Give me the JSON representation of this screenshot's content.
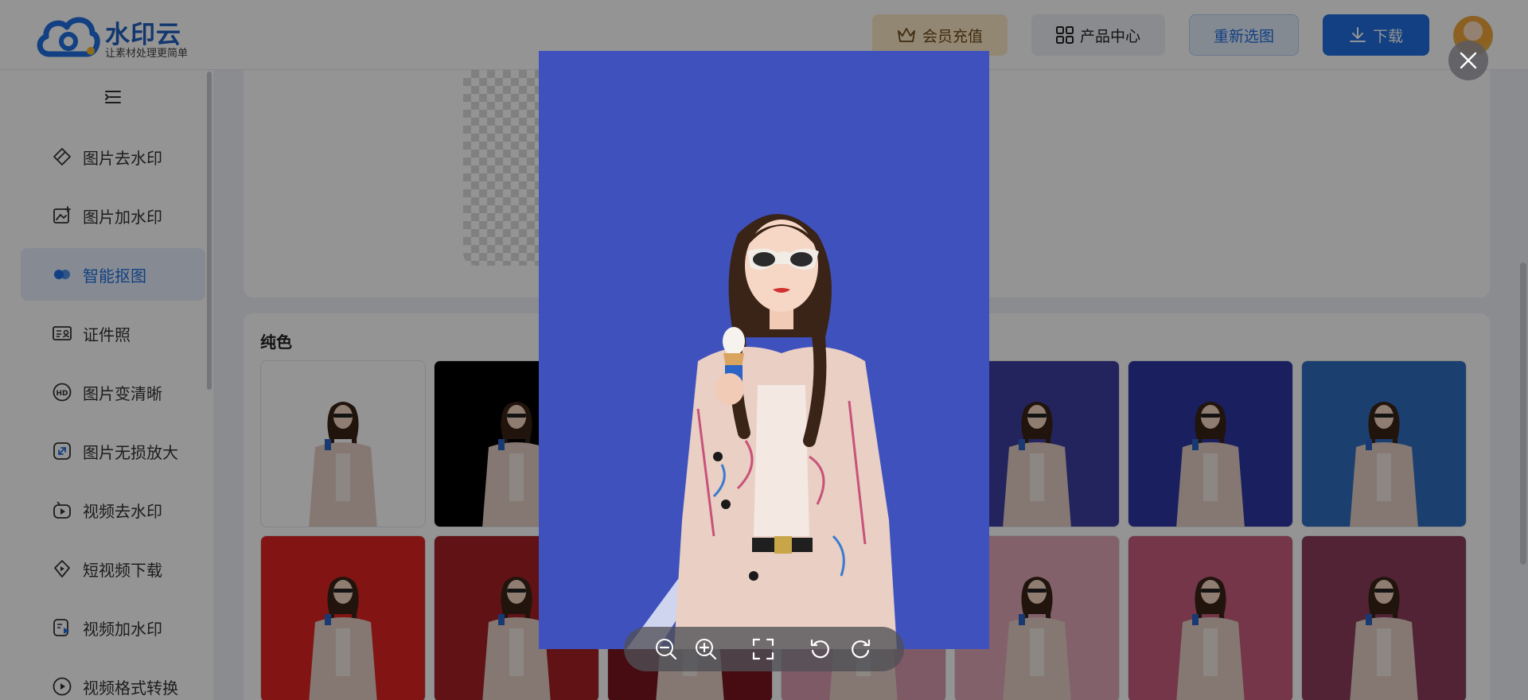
{
  "header": {
    "logo_name": "水印云",
    "logo_slogan": "让素材处理更简单",
    "vip_label": "会员充值",
    "products_label": "产品中心",
    "reselect_label": "重新选图",
    "download_label": "下载"
  },
  "sidebar": {
    "items": [
      {
        "label": "图片去水印",
        "icon": "eraser-icon",
        "active": false
      },
      {
        "label": "图片加水印",
        "icon": "image-add-icon",
        "active": false
      },
      {
        "label": "智能抠图",
        "icon": "cutout-icon",
        "active": true
      },
      {
        "label": "证件照",
        "icon": "id-card-icon",
        "active": false
      },
      {
        "label": "图片变清晰",
        "icon": "hd-icon",
        "active": false
      },
      {
        "label": "图片无损放大",
        "icon": "enlarge-icon",
        "active": false
      },
      {
        "label": "视频去水印",
        "icon": "video-eraser-icon",
        "active": false
      },
      {
        "label": "短视频下载",
        "icon": "video-download-icon",
        "active": false
      },
      {
        "label": "视频加水印",
        "icon": "video-add-icon",
        "active": false
      },
      {
        "label": "视频格式转换",
        "icon": "video-convert-icon",
        "active": false
      }
    ]
  },
  "colors_section": {
    "title": "纯色",
    "swatches_row1": [
      "#ffffff",
      "#000000",
      "#4a52b8",
      "#6a6ab0",
      "#3d3fa0",
      "#2e36a6",
      "#2f6fc0",
      "#3aa2d2"
    ],
    "swatches_row2": [
      "#e02424",
      "#a51f24",
      "#7a1620",
      "#d99ab0",
      "#e1a7b8",
      "#c85d7c",
      "#8c3d5c"
    ]
  },
  "preview": {
    "background": "#3f51bd"
  },
  "colors": {
    "accent": "#1f6fe0",
    "vip_bg": "#fbe8c6"
  }
}
